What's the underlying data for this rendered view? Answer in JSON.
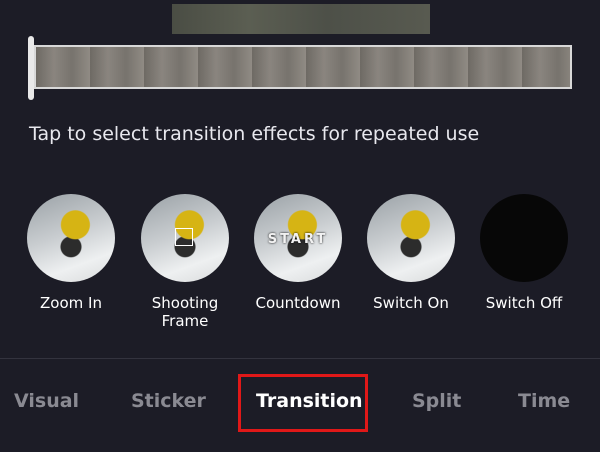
{
  "hint_text": "Tap to select transition effects for repeated use",
  "effects": [
    {
      "label": "Zoom In",
      "thumb": "snow"
    },
    {
      "label": "Shooting Frame",
      "thumb": "snow"
    },
    {
      "label": "Countdown",
      "thumb": "snow",
      "overlay_text": "START"
    },
    {
      "label": "Switch On",
      "thumb": "snow"
    },
    {
      "label": "Switch Off",
      "thumb": "dark"
    }
  ],
  "tabs": [
    {
      "label": "Visual",
      "active": false
    },
    {
      "label": "Sticker",
      "active": false
    },
    {
      "label": "Transition",
      "active": true
    },
    {
      "label": "Split",
      "active": false
    },
    {
      "label": "Time",
      "active": false
    }
  ],
  "colors": {
    "background": "#1c1c26",
    "active_tab": "#ffffff",
    "inactive_tab": "#8a8a92",
    "highlight": "#e01818"
  }
}
